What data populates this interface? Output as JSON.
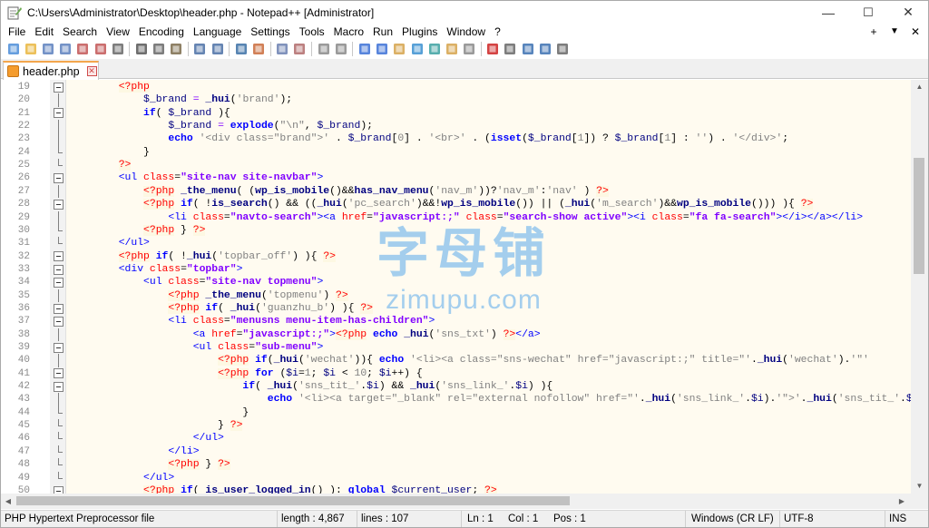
{
  "window": {
    "title": "C:\\Users\\Administrator\\Desktop\\header.php - Notepad++ [Administrator]",
    "controls": {
      "minimize": "—",
      "maximize": "☐",
      "close": "✕"
    }
  },
  "menu": {
    "items": [
      "File",
      "Edit",
      "Search",
      "View",
      "Encoding",
      "Language",
      "Settings",
      "Tools",
      "Macro",
      "Run",
      "Plugins",
      "Window",
      "?"
    ],
    "right": [
      "+",
      "▼",
      "✕"
    ]
  },
  "toolbar": {
    "buttons": [
      "new-file",
      "open-file",
      "save",
      "save-all",
      "close",
      "close-all",
      "print",
      "cut",
      "copy",
      "paste",
      "undo",
      "redo",
      "find",
      "replace",
      "zoom-in",
      "zoom-out",
      "sync-vertical",
      "sync-horizontal",
      "word-wrap",
      "show-all-chars",
      "indent-guide",
      "document-map",
      "function-list",
      "folder-as-workspace",
      "monitoring",
      "record-macro",
      "stop-macro",
      "play-macro",
      "run-macro-multiple",
      "save-macro"
    ]
  },
  "tab": {
    "label": "header.php",
    "close": "✕"
  },
  "editor": {
    "lines": [
      {
        "n": "19",
        "fold": "open",
        "code": "        <span class='p'>&lt;?php</span>"
      },
      {
        "n": "20",
        "fold": "line",
        "code": "            <span class='v'>$_brand</span> <span class='o'>=</span> <span class='fn'>_hui</span>(<span class='s'>'brand'</span>);"
      },
      {
        "n": "21",
        "fold": "open",
        "code": "            <span class='k'>if</span>( <span class='v'>$_brand</span> ){"
      },
      {
        "n": "22",
        "fold": "line",
        "code": "                <span class='v'>$_brand</span> <span class='o'>=</span> <span class='k'>explode</span>(<span class='s'>\"\\n\"</span>, <span class='v'>$_brand</span>);"
      },
      {
        "n": "23",
        "fold": "line",
        "code": "                <span class='k'>echo</span> <span class='s'>'&lt;div class=\"brand\"&gt;'</span> . <span class='v'>$_brand</span>[<span class='s'>0</span>] . <span class='s'>'&lt;br&gt;'</span> . (<span class='k'>isset</span>(<span class='v'>$_brand</span>[<span class='s'>1</span>]) ? <span class='v'>$_brand</span>[<span class='s'>1</span>] : <span class='s'>''</span>) . <span class='s'>'&lt;/div&gt;'</span>;"
      },
      {
        "n": "24",
        "fold": "end",
        "code": "            }"
      },
      {
        "n": "25",
        "fold": "end",
        "code": "        <span class='p'>?&gt;</span>"
      },
      {
        "n": "26",
        "fold": "open",
        "code": "        <span class='t'>&lt;ul</span> <span class='a'>class</span>=<span class='av'>\"site-nav site-navbar\"</span><span class='t'>&gt;</span>"
      },
      {
        "n": "27",
        "fold": "line",
        "code": "            <span class='p'>&lt;?php</span> <span class='fn'>_the_menu</span>( (<span class='fn'>wp_is_mobile</span>()&amp;&amp;<span class='fn'>has_nav_menu</span>(<span class='s'>'nav_m'</span>))?<span class='s'>'nav_m'</span>:<span class='s'>'nav'</span> ) <span class='p'>?&gt;</span>"
      },
      {
        "n": "28",
        "fold": "open",
        "code": "            <span class='p'>&lt;?php</span> <span class='k'>if</span>( !<span class='fn'>is_search</span>() &amp;&amp; ((<span class='fn'>_hui</span>(<span class='s'>'pc_search'</span>)&amp;&amp;!<span class='fn'>wp_is_mobile</span>()) || (<span class='fn'>_hui</span>(<span class='s'>'m_search'</span>)&amp;&amp;<span class='fn'>wp_is_mobile</span>())) ){ <span class='p'>?&gt;</span>"
      },
      {
        "n": "29",
        "fold": "line",
        "code": "                <span class='t'>&lt;li</span> <span class='a'>class</span>=<span class='av'>\"navto-search\"</span><span class='t'>&gt;&lt;a</span> <span class='a'>href</span>=<span class='av'>\"javascript:;\"</span> <span class='a'>class</span>=<span class='av'>\"search-show active\"</span><span class='t'>&gt;&lt;i</span> <span class='a'>class</span>=<span class='av'>\"fa fa-search\"</span><span class='t'>&gt;&lt;/i&gt;&lt;/a&gt;&lt;/li&gt;</span>"
      },
      {
        "n": "30",
        "fold": "end",
        "code": "            <span class='p'>&lt;?php</span> } <span class='p'>?&gt;</span>"
      },
      {
        "n": "31",
        "fold": "end",
        "code": "        <span class='t'>&lt;/ul&gt;</span>"
      },
      {
        "n": "32",
        "fold": "open",
        "code": "        <span class='p'>&lt;?php</span> <span class='k'>if</span>( !<span class='fn'>_hui</span>(<span class='s'>'topbar_off'</span>) ){ <span class='p'>?&gt;</span>"
      },
      {
        "n": "33",
        "fold": "open",
        "code": "        <span class='t'>&lt;div</span> <span class='a'>class</span>=<span class='av'>\"topbar\"</span><span class='t'>&gt;</span>"
      },
      {
        "n": "34",
        "fold": "open",
        "code": "            <span class='t'>&lt;ul</span> <span class='a'>class</span>=<span class='av'>\"site-nav topmenu\"</span><span class='t'>&gt;</span>"
      },
      {
        "n": "35",
        "fold": "line",
        "code": "                <span class='p'>&lt;?php</span> <span class='fn'>_the_menu</span>(<span class='s'>'topmenu'</span>) <span class='p'>?&gt;</span>"
      },
      {
        "n": "36",
        "fold": "open",
        "code": "                <span class='p'>&lt;?php</span> <span class='k'>if</span>( <span class='fn'>_hui</span>(<span class='s'>'guanzhu_b'</span>) ){ <span class='p'>?&gt;</span>"
      },
      {
        "n": "37",
        "fold": "open",
        "code": "                <span class='t'>&lt;li</span> <span class='a'>class</span>=<span class='av'>\"menusns menu-item-has-children\"</span><span class='t'>&gt;</span>"
      },
      {
        "n": "38",
        "fold": "line",
        "code": "                    <span class='t'>&lt;a</span> <span class='a'>href</span>=<span class='av'>\"javascript:;\"</span><span class='t'>&gt;</span><span class='p'>&lt;?php</span> <span class='k'>echo</span> <span class='fn'>_hui</span>(<span class='s'>'sns_txt'</span>) <span class='p'>?&gt;</span><span class='t'>&lt;/a&gt;</span>"
      },
      {
        "n": "39",
        "fold": "open",
        "code": "                    <span class='t'>&lt;ul</span> <span class='a'>class</span>=<span class='av'>\"sub-menu\"</span><span class='t'>&gt;</span>"
      },
      {
        "n": "40",
        "fold": "line",
        "code": "                        <span class='p'>&lt;?php</span> <span class='k'>if</span>(<span class='fn'>_hui</span>(<span class='s'>'wechat'</span>)){ <span class='k'>echo</span> <span class='s'>'&lt;li&gt;&lt;a class=\"sns-wechat\" href=\"javascript:;\" title=\"'</span>.<span class='fn'>_hui</span>(<span class='s'>'wechat'</span>).<span class='s'>'\"'</span>"
      },
      {
        "n": "41",
        "fold": "open",
        "code": "                        <span class='p'>&lt;?php</span> <span class='k'>for</span> (<span class='v'>$i</span>=<span class='s'>1</span>; <span class='v'>$i</span> &lt; <span class='s'>10</span>; <span class='v'>$i</span>++) {"
      },
      {
        "n": "42",
        "fold": "open",
        "code": "                            <span class='k'>if</span>( <span class='fn'>_hui</span>(<span class='s'>'sns_tit_'</span>.<span class='v'>$i</span>) &amp;&amp; <span class='fn'>_hui</span>(<span class='s'>'sns_link_'</span>.<span class='v'>$i</span>) ){"
      },
      {
        "n": "43",
        "fold": "line",
        "code": "                                <span class='k'>echo</span> <span class='s'>'&lt;li&gt;&lt;a target=\"_blank\" rel=\"external nofollow\" href=\"'</span>.<span class='fn'>_hui</span>(<span class='s'>'sns_link_'</span>.<span class='v'>$i</span>).<span class='s'>'\"&gt;'</span>.<span class='fn'>_hui</span>(<span class='s'>'sns_tit_'</span>.<span class='v'>$i</span>).<span class='s'>'&lt;/a&gt;&lt;/li&gt;'</span>;"
      },
      {
        "n": "44",
        "fold": "end",
        "code": "                            }"
      },
      {
        "n": "45",
        "fold": "end",
        "code": "                        } <span class='p'>?&gt;</span>"
      },
      {
        "n": "46",
        "fold": "end",
        "code": "                    <span class='t'>&lt;/ul&gt;</span>"
      },
      {
        "n": "47",
        "fold": "end",
        "code": "                <span class='t'>&lt;/li&gt;</span>"
      },
      {
        "n": "48",
        "fold": "end",
        "code": "                <span class='p'>&lt;?php</span> } <span class='p'>?&gt;</span>"
      },
      {
        "n": "49",
        "fold": "end",
        "code": "            <span class='t'>&lt;/ul&gt;</span>"
      },
      {
        "n": "50",
        "fold": "open",
        "code": "            <span class='p'>&lt;?php</span> <span class='k'>if</span>( <span class='fn'>is_user_logged_in</span>() ): <span class='k'>global</span> <span class='v'>$current_user</span>; <span class='p'>?&gt;</span>"
      }
    ]
  },
  "watermark": {
    "cn": "字母铺",
    "en": "zimupu.com"
  },
  "statusbar": {
    "file_type": "PHP Hypertext Preprocessor file",
    "length": "length : 4,867",
    "lines": "lines : 107",
    "ln": "Ln : 1",
    "col": "Col : 1",
    "pos": "Pos : 1",
    "eol": "Windows (CR LF)",
    "encoding": "UTF-8",
    "mode": "INS"
  },
  "colors": {
    "accent": "#f3a64d",
    "keyword": "#0000ff",
    "string": "#808080",
    "php_tag": "#ff0000",
    "attr_value": "#8000ff",
    "current_line": "#fffbf0"
  }
}
